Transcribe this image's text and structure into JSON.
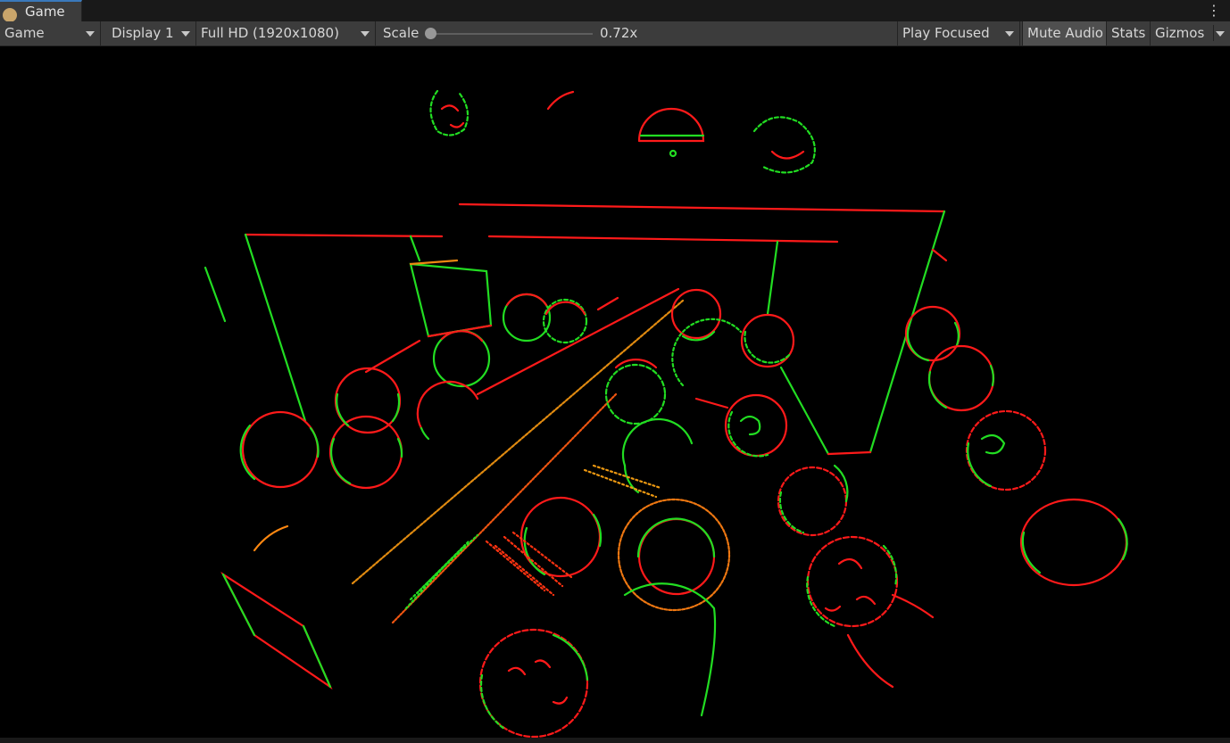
{
  "window": {
    "tab_label": "Game",
    "tab_icon": "game-controller-icon",
    "menu_icon": "kebab-menu-icon",
    "menu_glyph": "⋮"
  },
  "toolbar": {
    "view_select": "Game",
    "display_select": "Display 1",
    "resolution_select": "Full HD (1920x1080)",
    "scale_label": "Scale",
    "scale_value": "0.72x",
    "scale_fraction": 0.0,
    "play_mode_select": "Play Focused",
    "mute_audio_label": "Mute Audio",
    "stats_label": "Stats",
    "gizmos_label": "Gizmos"
  },
  "viewport": {
    "background": "#000000",
    "edge_colors": {
      "positive": "#ff1a1a",
      "negative": "#22dd22"
    }
  }
}
